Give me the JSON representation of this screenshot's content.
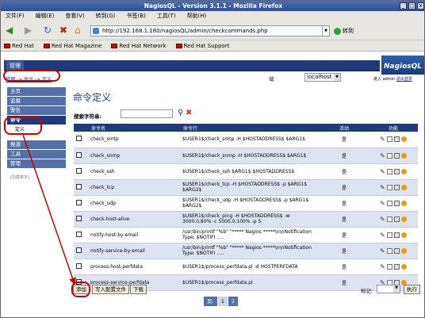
{
  "window": {
    "title": "NagiosQL - Version 3.1.1 - Mozilla Firefox"
  },
  "menu": [
    "文件(F)",
    "编辑(E)",
    "查看(V)",
    "转到(G)",
    "书签(B)",
    "工具(T)",
    "帮助(H)"
  ],
  "nav": {
    "url": "http://192.168.1.180/nagiosQL/admin/checkcommands.php",
    "go_label": "转到"
  },
  "bookmarks": [
    "Red Hat",
    "Red Hat Magazine",
    "Red Hat Network",
    "Red Hat Support"
  ],
  "header": {
    "manage_tab": "管理",
    "logo": "NagiosQL"
  },
  "breadcrumb": "管理 -> 命令 -> 定义",
  "host": {
    "label": "域:",
    "value": "localhost"
  },
  "login": {
    "prefix": "进入 admin",
    "logout": "退出登录"
  },
  "sidebar": {
    "items": [
      "主页",
      "监督",
      "警告",
      "命令",
      "定义",
      "报道",
      "工具",
      "管理"
    ],
    "note": "[隐藏菜单]"
  },
  "page": {
    "title": "命令定义",
    "search_label": "搜索字符串:"
  },
  "table": {
    "headers": [
      "命令名",
      "命令行",
      "活动",
      "功能"
    ],
    "rows": [
      {
        "name": "check_smtp",
        "cmd": "$USER1$/check_smtp -H $HOSTADDRESS$ $ARG1$",
        "active": "是"
      },
      {
        "name": "check_snmp",
        "cmd": "$USER1$/check_snmp -H $HOSTADDRESS$ $ARG1$",
        "active": "是"
      },
      {
        "name": "check_ssh",
        "cmd": "$USER1$/check_ssh $ARG1$ $HOSTADDRESS$",
        "active": "是"
      },
      {
        "name": "check_tcp",
        "cmd": "$USER1$/check_tcp -H $HOSTADDRESS$ -p $ARG1$ $ARG2$",
        "active": "是"
      },
      {
        "name": "check_udp",
        "cmd": "$USER1$/check_udp -H $HOSTADDRESS$ -p $ARG1$ $ARG2$",
        "active": "是"
      },
      {
        "name": "check-host-alive",
        "cmd": "$USER1$/check_ping -H $HOSTADDRESS$ -w 3000.0,80% -c 5000.0,100% -p 5",
        "active": "是"
      },
      {
        "name": "notify-host-by-email",
        "cmd": "/usr/bin/printf \"%b\" \"***** Nagios *****\\n\\nNotification Type: $NOTIFI .....",
        "active": "是"
      },
      {
        "name": "notify-service-by-email",
        "cmd": "/usr/bin/printf \"%b\" \"***** Nagios *****\\n\\nNotification Type: $NOTIFI .....",
        "active": "是"
      },
      {
        "name": "process-host-perfdata",
        "cmd": "$USER1$/process_perfdata.pl -d HOSTPERFDATA",
        "active": "是"
      },
      {
        "name": "process-service-perfdata",
        "cmd": "$USER1$/process_perfdata.pl",
        "active": "是"
      }
    ]
  },
  "buttons": {
    "add": "添加",
    "write_config": "写入配置文件",
    "download": "下载",
    "execute": "执行"
  },
  "mark_label": "标记:",
  "pager": {
    "label": "页:",
    "pages": [
      "1",
      "2"
    ]
  }
}
